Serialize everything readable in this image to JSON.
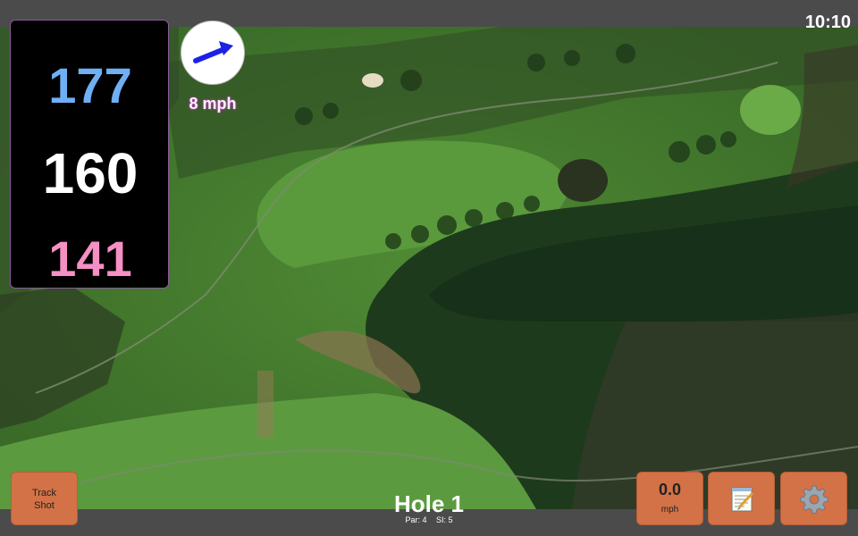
{
  "status": {
    "time": "10:10"
  },
  "distances": {
    "back": "177",
    "middle": "160",
    "front": "141"
  },
  "wind": {
    "speed": "8 mph",
    "direction_icon": "arrow-right-up-icon"
  },
  "buttons": {
    "track_line1": "Track",
    "track_line2": "Shot",
    "speed_value": "0.0",
    "speed_unit": "mph",
    "notes_icon": "notepad-icon",
    "settings_icon": "gear-icon"
  },
  "hole": {
    "title": "Hole 1",
    "par": "Par: 4",
    "si": "SI: 5"
  },
  "colors": {
    "back_distance": "#6fb0f5",
    "middle_distance": "#ffffff",
    "front_distance": "#f58fc4",
    "button_bg": "#d37246",
    "wind_arrow": "#1a22e6"
  }
}
